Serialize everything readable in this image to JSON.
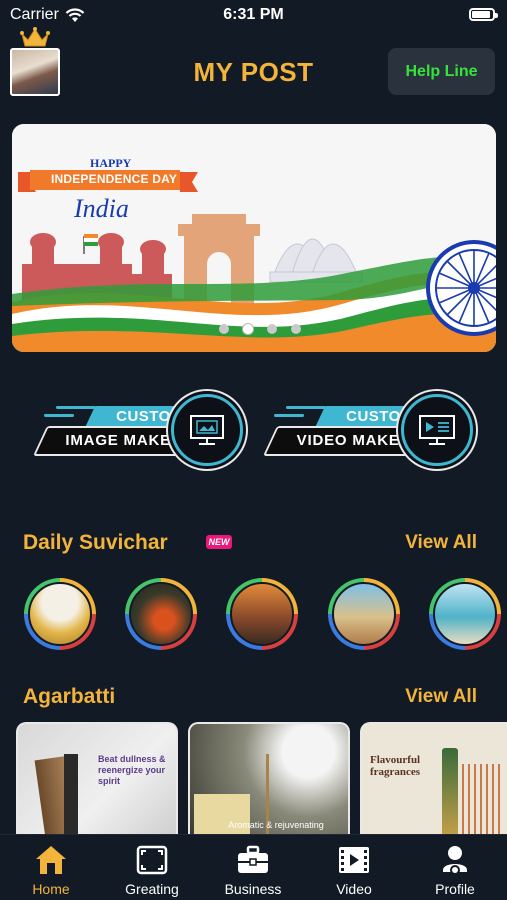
{
  "status_bar": {
    "carrier": "Carrier",
    "time": "6:31 PM"
  },
  "header": {
    "title": "MY POST",
    "help_button": "Help Line"
  },
  "banner": {
    "line1": "HAPPY",
    "line2": "INDEPENDENCE DAY",
    "line3": "India",
    "page_count": 4,
    "active_page": 2
  },
  "makers": [
    {
      "top_label": "CUSTOM",
      "main_label": "IMAGE MAKER",
      "icon": "image-editor-icon"
    },
    {
      "top_label": "CUSTOM",
      "main_label": "VIDEO MAKER",
      "icon": "video-editor-icon"
    }
  ],
  "sections": {
    "suvichar": {
      "title": "Daily Suvichar",
      "view_all": "View All",
      "badge": "NEW"
    },
    "agarbatti": {
      "title": "Agarbatti",
      "view_all": "View All"
    }
  },
  "suvichar_items": [
    {
      "theme": "warm-sunset"
    },
    {
      "theme": "autumn-leaves"
    },
    {
      "theme": "silhouette-sunset"
    },
    {
      "theme": "beach-couple"
    },
    {
      "theme": "seaside"
    }
  ],
  "agarbatti_cards": [
    {
      "text": "Beat dullness & reenergize your spirit"
    },
    {
      "text": "Aromatic & rejuvenating"
    },
    {
      "text": "Flavourful fragrances"
    }
  ],
  "nav": [
    {
      "label": "Home",
      "icon": "home-icon",
      "active": true
    },
    {
      "label": "Greating",
      "icon": "frame-icon",
      "active": false
    },
    {
      "label": "Business",
      "icon": "briefcase-icon",
      "active": false
    },
    {
      "label": "Video",
      "icon": "film-icon",
      "active": false
    },
    {
      "label": "Profile",
      "icon": "profile-icon",
      "active": false
    }
  ],
  "colors": {
    "background": "#121a26",
    "accent": "#f2b43a",
    "help_text": "#36e33a",
    "maker_blue": "#3fb7d1"
  }
}
